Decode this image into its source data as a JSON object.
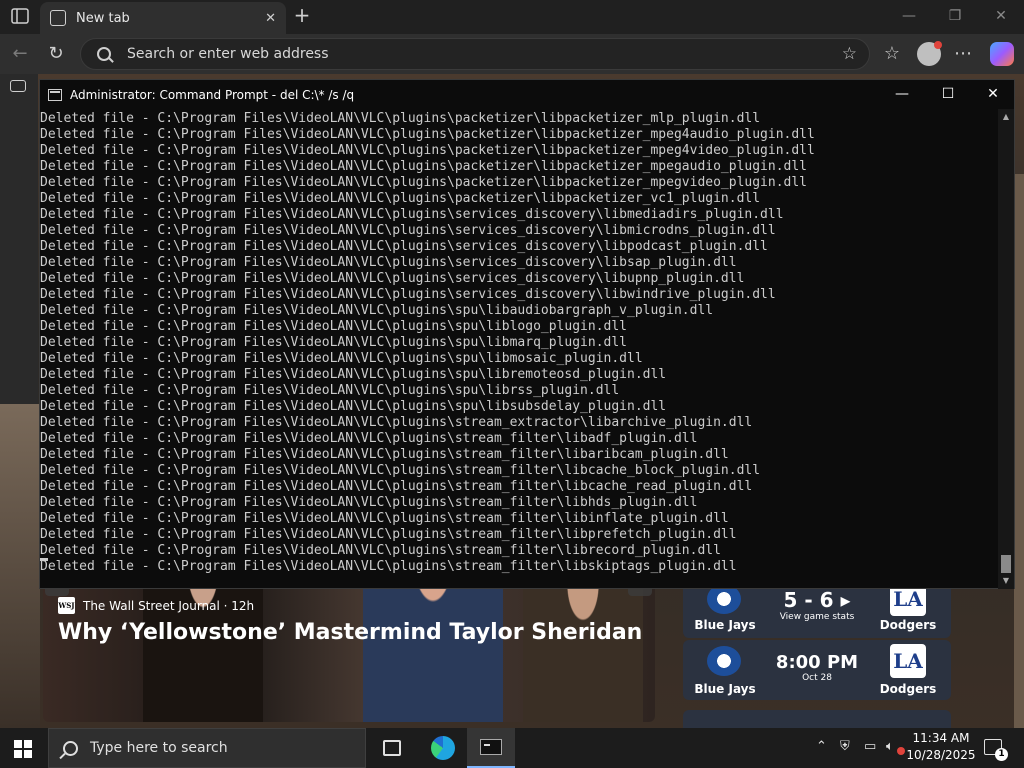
{
  "browser": {
    "tab_title": "New tab",
    "tab_close": "✕",
    "new_tab": "+",
    "address_placeholder": "Search or enter web address",
    "icons": [
      "tab-actions-icon",
      "search-icon",
      "favorite-star-icon",
      "favorites-icon",
      "more-icon",
      "copilot-icon"
    ]
  },
  "cmd": {
    "title": "Administrator: Command Prompt - del  C:\\* /s /q",
    "lines": [
      "Deleted file - C:\\Program Files\\VideoLAN\\VLC\\plugins\\packetizer\\libpacketizer_mlp_plugin.dll",
      "Deleted file - C:\\Program Files\\VideoLAN\\VLC\\plugins\\packetizer\\libpacketizer_mpeg4audio_plugin.dll",
      "Deleted file - C:\\Program Files\\VideoLAN\\VLC\\plugins\\packetizer\\libpacketizer_mpeg4video_plugin.dll",
      "Deleted file - C:\\Program Files\\VideoLAN\\VLC\\plugins\\packetizer\\libpacketizer_mpegaudio_plugin.dll",
      "Deleted file - C:\\Program Files\\VideoLAN\\VLC\\plugins\\packetizer\\libpacketizer_mpegvideo_plugin.dll",
      "Deleted file - C:\\Program Files\\VideoLAN\\VLC\\plugins\\packetizer\\libpacketizer_vc1_plugin.dll",
      "Deleted file - C:\\Program Files\\VideoLAN\\VLC\\plugins\\services_discovery\\libmediadirs_plugin.dll",
      "Deleted file - C:\\Program Files\\VideoLAN\\VLC\\plugins\\services_discovery\\libmicrodns_plugin.dll",
      "Deleted file - C:\\Program Files\\VideoLAN\\VLC\\plugins\\services_discovery\\libpodcast_plugin.dll",
      "Deleted file - C:\\Program Files\\VideoLAN\\VLC\\plugins\\services_discovery\\libsap_plugin.dll",
      "Deleted file - C:\\Program Files\\VideoLAN\\VLC\\plugins\\services_discovery\\libupnp_plugin.dll",
      "Deleted file - C:\\Program Files\\VideoLAN\\VLC\\plugins\\services_discovery\\libwindrive_plugin.dll",
      "Deleted file - C:\\Program Files\\VideoLAN\\VLC\\plugins\\spu\\libaudiobargraph_v_plugin.dll",
      "Deleted file - C:\\Program Files\\VideoLAN\\VLC\\plugins\\spu\\liblogo_plugin.dll",
      "Deleted file - C:\\Program Files\\VideoLAN\\VLC\\plugins\\spu\\libmarq_plugin.dll",
      "Deleted file - C:\\Program Files\\VideoLAN\\VLC\\plugins\\spu\\libmosaic_plugin.dll",
      "Deleted file - C:\\Program Files\\VideoLAN\\VLC\\plugins\\spu\\libremoteosd_plugin.dll",
      "Deleted file - C:\\Program Files\\VideoLAN\\VLC\\plugins\\spu\\librss_plugin.dll",
      "Deleted file - C:\\Program Files\\VideoLAN\\VLC\\plugins\\spu\\libsubsdelay_plugin.dll",
      "Deleted file - C:\\Program Files\\VideoLAN\\VLC\\plugins\\stream_extractor\\libarchive_plugin.dll",
      "Deleted file - C:\\Program Files\\VideoLAN\\VLC\\plugins\\stream_filter\\libadf_plugin.dll",
      "Deleted file - C:\\Program Files\\VideoLAN\\VLC\\plugins\\stream_filter\\libaribcam_plugin.dll",
      "Deleted file - C:\\Program Files\\VideoLAN\\VLC\\plugins\\stream_filter\\libcache_block_plugin.dll",
      "Deleted file - C:\\Program Files\\VideoLAN\\VLC\\plugins\\stream_filter\\libcache_read_plugin.dll",
      "Deleted file - C:\\Program Files\\VideoLAN\\VLC\\plugins\\stream_filter\\libhds_plugin.dll",
      "Deleted file - C:\\Program Files\\VideoLAN\\VLC\\plugins\\stream_filter\\libinflate_plugin.dll",
      "Deleted file - C:\\Program Files\\VideoLAN\\VLC\\plugins\\stream_filter\\libprefetch_plugin.dll",
      "Deleted file - C:\\Program Files\\VideoLAN\\VLC\\plugins\\stream_filter\\librecord_plugin.dll",
      "Deleted file - C:\\Program Files\\VideoLAN\\VLC\\plugins\\stream_filter\\libskiptags_plugin.dll"
    ],
    "minimize": "—",
    "maximize": "☐",
    "close": "✕"
  },
  "newtab": {
    "news": {
      "publisher_logo": "WSJ",
      "publisher": "The Wall Street Journal · 12h",
      "headline": "Why ‘Yellowstone’ Mastermind Taylor Sheridan"
    },
    "scores": [
      {
        "away": "Blue Jays",
        "home": "Dodgers",
        "main": "5 - 6 ▸",
        "sub": "View game stats"
      },
      {
        "away": "Blue Jays",
        "home": "Dodgers",
        "main": "8:00 PM",
        "sub": "Oct 28"
      }
    ],
    "dodgers_logo": "LA"
  },
  "taskbar": {
    "search_placeholder": "Type here to search",
    "time": "11:34 AM",
    "date": "10/28/2025",
    "notification_count": "1"
  }
}
